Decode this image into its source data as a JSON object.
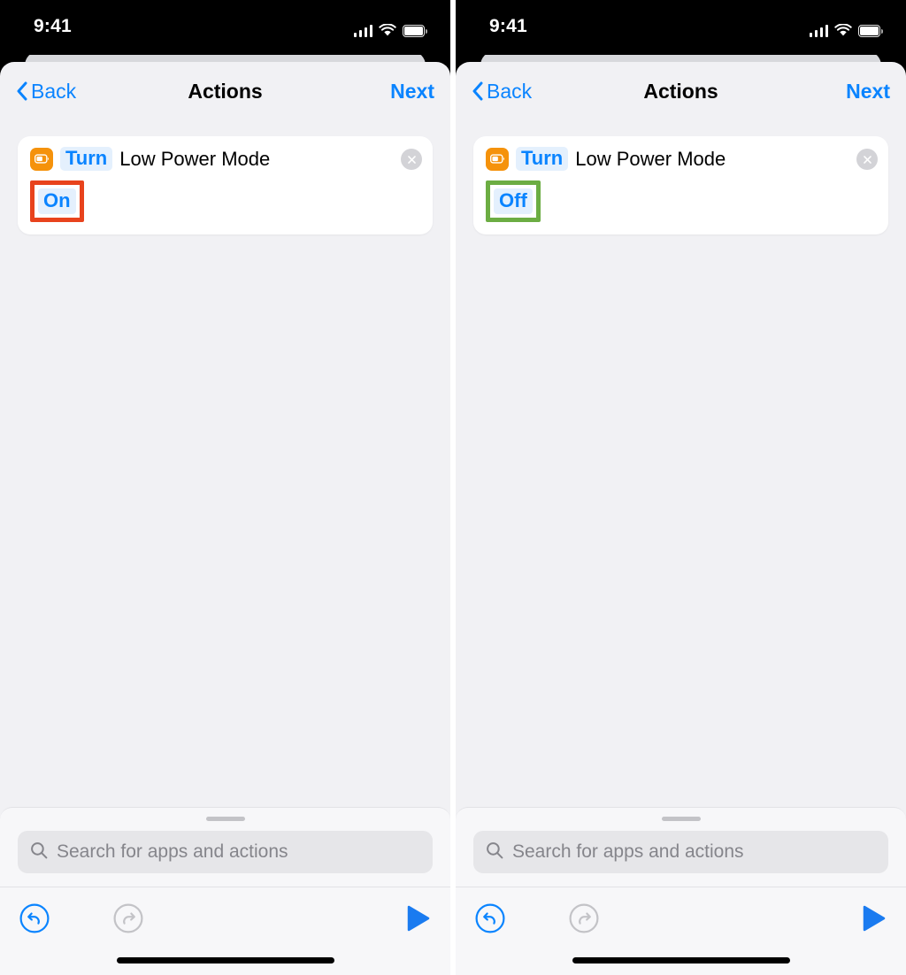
{
  "statusbar": {
    "time": "9:41",
    "icons": [
      "cellular-signal-icon",
      "wifi-icon",
      "battery-icon"
    ]
  },
  "nav": {
    "back_label": "Back",
    "title": "Actions",
    "next_label": "Next"
  },
  "action": {
    "app_icon": "low-power-mode-battery-icon",
    "verb_token": "Turn",
    "subject": "Low Power Mode",
    "delete_icon": "close-circle-icon"
  },
  "search": {
    "placeholder": "Search for apps and actions",
    "icon": "search-icon"
  },
  "toolbar": {
    "undo_icon": "undo-arrow-icon",
    "redo_icon": "redo-arrow-icon",
    "run_icon": "play-triangle-icon"
  },
  "colors": {
    "accent_blue": "#0a84ff",
    "app_orange": "#f5920b",
    "highlight_red": "#e8431d",
    "highlight_green": "#6cad43",
    "sheet_bg": "#f1f1f4",
    "card_bg": "#ffffff"
  },
  "panels": [
    {
      "id": "left",
      "state_value": "On",
      "highlight_color": "#e8431d",
      "highlight_style": "red"
    },
    {
      "id": "right",
      "state_value": "Off",
      "highlight_color": "#6cad43",
      "highlight_style": "green"
    }
  ]
}
